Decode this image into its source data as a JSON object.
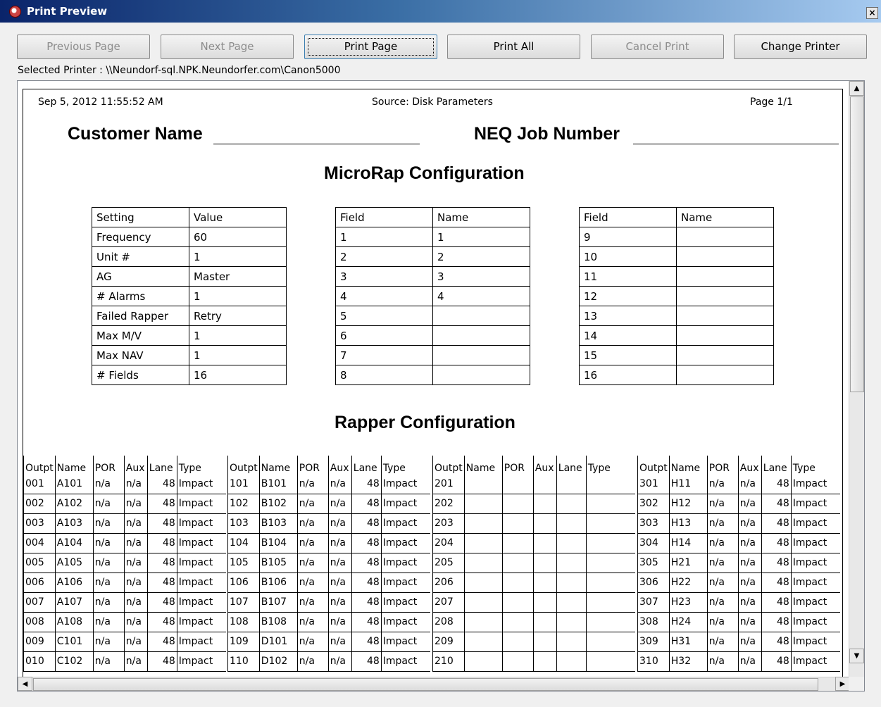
{
  "window": {
    "title": "Print Preview",
    "close_label": "×"
  },
  "toolbar": {
    "previous_page": "Previous Page",
    "next_page": "Next Page",
    "print_page": "Print Page",
    "print_all": "Print All",
    "cancel_print": "Cancel Print",
    "change_printer": "Change Printer"
  },
  "selected_printer": "Selected Printer : \\\\Neundorf-sql.NPK.Neundorfer.com\\Canon5000",
  "page": {
    "date": "Sep 5, 2012 11:55:52 AM",
    "source": "Source: Disk Parameters",
    "page_num": "Page 1/1",
    "customer_name_label": "Customer Name",
    "job_number_label": "NEQ Job Number",
    "microrap_title": "MicroRap Configuration",
    "rapper_title": "Rapper Configuration"
  },
  "settings_table": [
    [
      "Setting",
      "Value"
    ],
    [
      "Frequency",
      "60"
    ],
    [
      "Unit #",
      "1"
    ],
    [
      "AG",
      "Master"
    ],
    [
      "# Alarms",
      "1"
    ],
    [
      "Failed Rapper",
      "Retry"
    ],
    [
      "Max M/V",
      "1"
    ],
    [
      "Max NAV",
      "1"
    ],
    [
      "# Fields",
      "16"
    ]
  ],
  "fields_table_1": [
    [
      "Field",
      "Name"
    ],
    [
      "1",
      "1"
    ],
    [
      "2",
      "2"
    ],
    [
      "3",
      "3"
    ],
    [
      "4",
      "4"
    ],
    [
      "5",
      ""
    ],
    [
      "6",
      ""
    ],
    [
      "7",
      ""
    ],
    [
      "8",
      ""
    ]
  ],
  "fields_table_2": [
    [
      "Field",
      "Name"
    ],
    [
      "9",
      ""
    ],
    [
      "10",
      ""
    ],
    [
      "11",
      ""
    ],
    [
      "12",
      ""
    ],
    [
      "13",
      ""
    ],
    [
      "14",
      ""
    ],
    [
      "15",
      ""
    ],
    [
      "16",
      ""
    ]
  ],
  "rapper_headers": [
    "Outpt",
    "Name",
    "POR",
    "Aux",
    "Lane",
    "Type"
  ],
  "rapper_groups": [
    [
      [
        "001",
        "A101",
        "n/a",
        "n/a",
        "48",
        "Impact"
      ],
      [
        "002",
        "A102",
        "n/a",
        "n/a",
        "48",
        "Impact"
      ],
      [
        "003",
        "A103",
        "n/a",
        "n/a",
        "48",
        "Impact"
      ],
      [
        "004",
        "A104",
        "n/a",
        "n/a",
        "48",
        "Impact"
      ],
      [
        "005",
        "A105",
        "n/a",
        "n/a",
        "48",
        "Impact"
      ],
      [
        "006",
        "A106",
        "n/a",
        "n/a",
        "48",
        "Impact"
      ],
      [
        "007",
        "A107",
        "n/a",
        "n/a",
        "48",
        "Impact"
      ],
      [
        "008",
        "A108",
        "n/a",
        "n/a",
        "48",
        "Impact"
      ],
      [
        "009",
        "C101",
        "n/a",
        "n/a",
        "48",
        "Impact"
      ],
      [
        "010",
        "C102",
        "n/a",
        "n/a",
        "48",
        "Impact"
      ]
    ],
    [
      [
        "101",
        "B101",
        "n/a",
        "n/a",
        "48",
        "Impact"
      ],
      [
        "102",
        "B102",
        "n/a",
        "n/a",
        "48",
        "Impact"
      ],
      [
        "103",
        "B103",
        "n/a",
        "n/a",
        "48",
        "Impact"
      ],
      [
        "104",
        "B104",
        "n/a",
        "n/a",
        "48",
        "Impact"
      ],
      [
        "105",
        "B105",
        "n/a",
        "n/a",
        "48",
        "Impact"
      ],
      [
        "106",
        "B106",
        "n/a",
        "n/a",
        "48",
        "Impact"
      ],
      [
        "107",
        "B107",
        "n/a",
        "n/a",
        "48",
        "Impact"
      ],
      [
        "108",
        "B108",
        "n/a",
        "n/a",
        "48",
        "Impact"
      ],
      [
        "109",
        "D101",
        "n/a",
        "n/a",
        "48",
        "Impact"
      ],
      [
        "110",
        "D102",
        "n/a",
        "n/a",
        "48",
        "Impact"
      ]
    ],
    [
      [
        "201",
        "",
        "",
        "",
        "",
        ""
      ],
      [
        "202",
        "",
        "",
        "",
        "",
        ""
      ],
      [
        "203",
        "",
        "",
        "",
        "",
        ""
      ],
      [
        "204",
        "",
        "",
        "",
        "",
        ""
      ],
      [
        "205",
        "",
        "",
        "",
        "",
        ""
      ],
      [
        "206",
        "",
        "",
        "",
        "",
        ""
      ],
      [
        "207",
        "",
        "",
        "",
        "",
        ""
      ],
      [
        "208",
        "",
        "",
        "",
        "",
        ""
      ],
      [
        "209",
        "",
        "",
        "",
        "",
        ""
      ],
      [
        "210",
        "",
        "",
        "",
        "",
        ""
      ]
    ],
    [
      [
        "301",
        "H11",
        "n/a",
        "n/a",
        "48",
        "Impact"
      ],
      [
        "302",
        "H12",
        "n/a",
        "n/a",
        "48",
        "Impact"
      ],
      [
        "303",
        "H13",
        "n/a",
        "n/a",
        "48",
        "Impact"
      ],
      [
        "304",
        "H14",
        "n/a",
        "n/a",
        "48",
        "Impact"
      ],
      [
        "305",
        "H21",
        "n/a",
        "n/a",
        "48",
        "Impact"
      ],
      [
        "306",
        "H22",
        "n/a",
        "n/a",
        "48",
        "Impact"
      ],
      [
        "307",
        "H23",
        "n/a",
        "n/a",
        "48",
        "Impact"
      ],
      [
        "308",
        "H24",
        "n/a",
        "n/a",
        "48",
        "Impact"
      ],
      [
        "309",
        "H31",
        "n/a",
        "n/a",
        "48",
        "Impact"
      ],
      [
        "310",
        "H32",
        "n/a",
        "n/a",
        "48",
        "Impact"
      ]
    ]
  ],
  "scrollbar": {
    "up_arrow": "▲",
    "down_arrow": "▼",
    "left_arrow": "◀",
    "right_arrow": "▶"
  }
}
